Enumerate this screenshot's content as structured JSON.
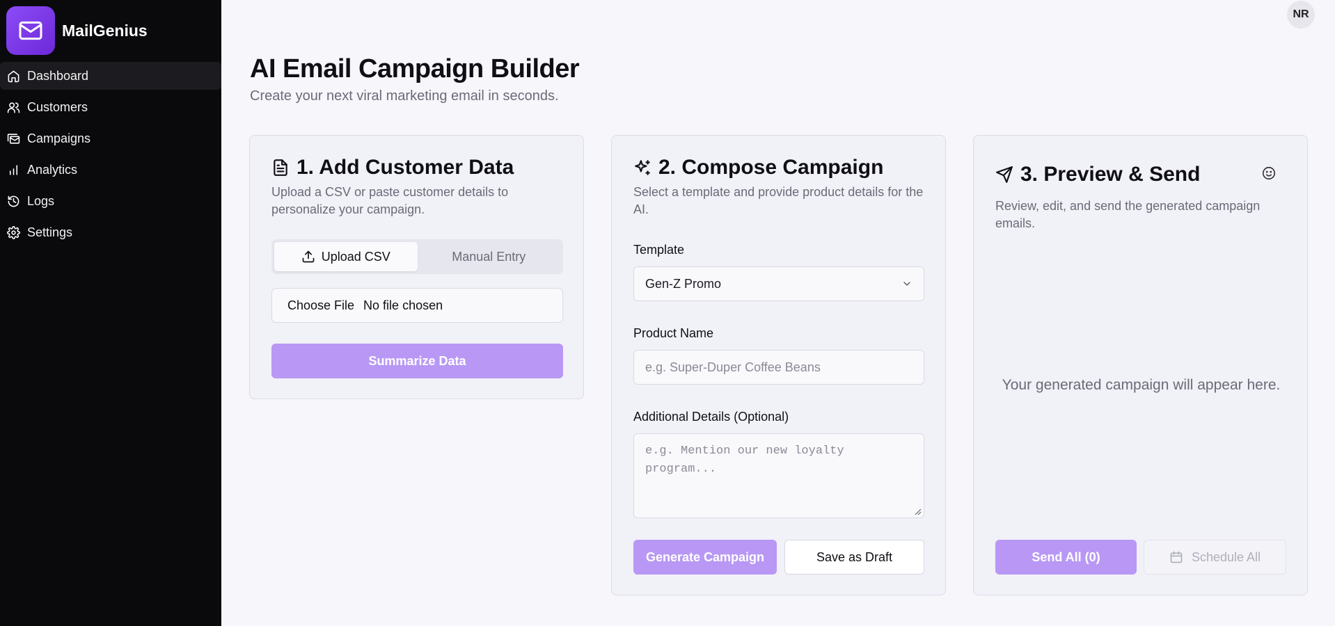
{
  "sidebar": {
    "brand": "MailGenius",
    "items": [
      {
        "label": "Dashboard",
        "icon": "home-icon"
      },
      {
        "label": "Customers",
        "icon": "users-icon"
      },
      {
        "label": "Campaigns",
        "icon": "mail-stack-icon"
      },
      {
        "label": "Analytics",
        "icon": "bar-chart-icon"
      },
      {
        "label": "Logs",
        "icon": "history-icon"
      },
      {
        "label": "Settings",
        "icon": "gear-icon"
      }
    ]
  },
  "user": {
    "initials": "NR"
  },
  "header": {
    "title": "AI Email Campaign Builder",
    "subtitle": "Create your next viral marketing email in seconds."
  },
  "card1": {
    "title": "1. Add Customer Data",
    "description": "Upload a CSV or paste customer details to personalize your campaign.",
    "tabs": [
      "Upload CSV",
      "Manual Entry"
    ],
    "file_button": "Choose File",
    "file_status": "No file chosen",
    "summarize_label": "Summarize Data"
  },
  "card2": {
    "title": "2. Compose Campaign",
    "description": "Select a template and provide product details for the AI.",
    "template_label": "Template",
    "template_value": "Gen-Z Promo",
    "product_label": "Product Name",
    "product_placeholder": "e.g. Super-Duper Coffee Beans",
    "details_label": "Additional Details (Optional)",
    "details_placeholder": "e.g. Mention our new loyalty program...",
    "generate_label": "Generate Campaign",
    "draft_label": "Save as Draft"
  },
  "card3": {
    "title": "3. Preview & Send",
    "description": "Review, edit, and send the generated campaign emails.",
    "empty_message": "Your generated campaign will appear here.",
    "send_label": "Send All (0)",
    "schedule_label": "Schedule All"
  },
  "colors": {
    "accent": "#8b4cf6",
    "button_disabled": "#b898f4",
    "sidebar_bg": "#0a0a0c",
    "page_bg": "#f6f6fb"
  }
}
